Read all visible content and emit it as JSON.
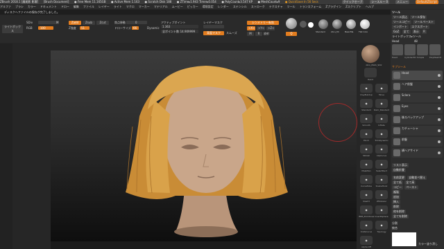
{
  "titlebar": {
    "app": "ZBrush 2018.1 [廣尾影 影響]",
    "document": "[Brush Document]",
    "free_mem": "● Free Mem 11.165GB",
    "active_mem": "● Active Mem 1.163",
    "scratch": "● Scratch Disk 188",
    "ztime": "● ZTime▸1.943 Timer▸0.054",
    "polycount": "● PolyCount▸3.547 KP",
    "meshcount": "● MeshCount▸9",
    "quicksave": "● QuickSave In 56 Secs",
    "quicksave_btn": "クイックセーブ",
    "see_through": "シースルー 0",
    "menus_btn": "メニュー",
    "script_btn": "DefaultZScript"
  },
  "menubar": [
    "アルファ",
    "ブラシ",
    "カラー",
    "ドキュメント",
    "ドロー",
    "編集",
    "ファイル",
    "レイヤー",
    "ライト",
    "マクロ",
    "マーカー",
    "マテリアル",
    "ムービー",
    "ピッカー",
    "環境設定",
    "レンダー",
    "ステンシル",
    "ストローク",
    "テクスチャ",
    "ツール",
    "トランスフォーム",
    "Zプラグイン",
    "Zスクリプト",
    "ヘルプ"
  ],
  "status": "ディスクへファイルの保存が完了しました。",
  "toolbar": {
    "lightbox": "ライトボックス",
    "sdiv_label": "SDiv",
    "dynamic_label": "ダイナミック",
    "color_label": "RGB",
    "m_label": "M",
    "zadd": "Zadd",
    "zsub": "Zsub",
    "zcut": "Zcut",
    "rgb_intensity": "RGB強度",
    "rgb_intensity_val": "100",
    "z_intensity": "Z強度",
    "z_intensity_val": "51",
    "focal_shift": "焦点移動",
    "focal_shift_val": "0",
    "draw_size": "ドローサイズ",
    "draw_size_val": "66",
    "dynamic2": "Dynamic",
    "active_points": "アクティブポイント",
    "active_points_val": "1.363",
    "total_points": "全ポイント数",
    "total_points_val": "14.909999",
    "layer_mask": "レイヤーマスク",
    "symmetry": "シンメトリー有効",
    "backface_mask": "背面マスク",
    "x": ">X<",
    "y": ">Y<",
    "z": ">Z<",
    "m": "M",
    "r": "R",
    "symmetry_radial": "放射",
    "morph": "モーフ",
    "smooth": "スムーズ"
  },
  "materials": {
    "thumb1_label": "Standard",
    "thumb2_label": "zbru_Mi",
    "thumb3_label": "BasicMa",
    "thumb4_label": "Flat Colo"
  },
  "leftshelf": {
    "sphere_label": "zbro_Mat1_SDir",
    "brush_label": "Hand",
    "items": [
      {
        "icon": "clay-icon",
        "label": "ClayBuildup"
      },
      {
        "icon": "move-icon",
        "label": "Move"
      },
      {
        "icon": "standard-icon",
        "label": "Standard"
      },
      {
        "icon": "dam-icon",
        "label": "Dam_Standard"
      },
      {
        "icon": "smooth-icon",
        "label": "Smooth"
      },
      {
        "icon": "inflate-icon",
        "label": "Inflate"
      },
      {
        "icon": "pinch-icon",
        "label": "Pinch"
      },
      {
        "icon": "trim-icon",
        "label": "TrimDynamic"
      },
      {
        "icon": "hpolish-icon",
        "label": "hPolish"
      },
      {
        "icon": "clip-icon",
        "label": "ClipCurve"
      },
      {
        "icon": "mask-icon",
        "label": "MaskPen"
      },
      {
        "icon": "select-icon",
        "label": "SelectRect"
      },
      {
        "icon": "curve-icon",
        "label": "CurveTube"
      },
      {
        "icon": "snake-icon",
        "label": "SnakeHook"
      },
      {
        "icon": "slash-icon",
        "label": "Slash3"
      },
      {
        "icon": "zmodeler-icon",
        "label": "ZModeler"
      },
      {
        "icon": "imm-icon",
        "label": "IMM_Primitives"
      },
      {
        "icon": "insert-icon",
        "label": "InsertSphere"
      },
      {
        "icon": "knife-icon",
        "label": "KnifeCurve"
      },
      {
        "icon": "topology-icon",
        "label": "Topology"
      },
      {
        "icon": "alpha-icon",
        "label": "Alpha Off"
      }
    ]
  },
  "rightshelf": {
    "buttons": [
      "◉",
      "▦",
      "◫",
      "◧",
      "⟳",
      "◎",
      "▤",
      "⊞",
      "⊟",
      "⊕",
      "◇",
      "◆",
      "▣",
      "▢",
      "⊗",
      "◈",
      "▧",
      "▨",
      "▩",
      "⧉",
      "▥"
    ],
    "labels": [
      "BPR",
      "SPix",
      "Scroll",
      "Zoom",
      "Actual",
      "AAHalf",
      "Persp",
      "Floor",
      "Local",
      "XYZ",
      "Frame",
      "Move",
      "Scale",
      "Rotate",
      "PolyF",
      "Transp",
      "Ghost",
      "Solo",
      "Xpose",
      "Dynamic",
      "Line"
    ]
  },
  "tray": {
    "title": "ツール",
    "load": "ツール読込",
    "save": "ツール保存",
    "copy": "ツールコピー",
    "paste": "ツールペースト",
    "import": "インポート",
    "export": "エクスポート",
    "goz": "GoZ",
    "all": "全て",
    "visible": "表示",
    "r": "R",
    "lightbox_tools": "ライトボックス▸ツール",
    "current_tool": "Head",
    "tool_count": "48",
    "thumbs": [
      "Head",
      "Cylinder3D",
      "Simple",
      "PolyMesh3D"
    ],
    "subtool_header": "サブツール",
    "subtools": [
      {
        "name": "Head",
        "icon": "head-thumb"
      },
      {
        "name": "ヘア前髪",
        "icon": "hair-thumb"
      },
      {
        "name": "Sclera",
        "icon": "sclera-thumb"
      },
      {
        "name": "Eyes",
        "icon": "eyes-thumb"
      },
      {
        "name": "後ろバックアップ",
        "icon": "hairback-thumb"
      },
      {
        "name": "カチューシャ",
        "icon": "band-thumb"
      },
      {
        "name": "前髪",
        "icon": "bangs-thumb"
      },
      {
        "name": "横ヘアサイド",
        "icon": "side-thumb"
      }
    ],
    "list_all": "リスト表示",
    "auto_collapse": "自動折畳",
    "rename": "名前変更",
    "auto_reorder": "自動並べ替え",
    "all_low": "全て低",
    "all_high": "全て高",
    "copy2": "コピー",
    "paste2": "ペースト",
    "duplicate": "複製",
    "append": "追加",
    "insert": "挿入",
    "delete": "削除",
    "del_other": "他を削除",
    "del_all": "全てを削除",
    "split": "分割",
    "merge": "統合",
    "color_bottom": "カラー塗り潰し",
    "color_label": "カラーパレット"
  },
  "colors": {
    "accent": "#e37d1f",
    "panel": "#2a2a2a",
    "bg": "#262626",
    "skin": "#c9a68a",
    "hair": "#d9a24a",
    "brush_ring": "#a02a2a"
  }
}
